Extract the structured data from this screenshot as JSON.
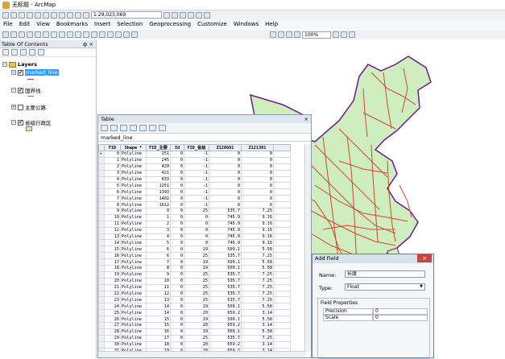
{
  "window": {
    "title": "无标题 - ArcMap"
  },
  "toolbar": {
    "scale": "1:29,023,069",
    "zoom": "100%"
  },
  "menu": [
    "File",
    "Edit",
    "View",
    "Bookmarks",
    "Insert",
    "Selection",
    "Geoprocessing",
    "Customize",
    "Windows",
    "Help"
  ],
  "toc": {
    "title": "Table Of Contents",
    "pin": "ф ×",
    "layers_label": "Layers",
    "layers": [
      {
        "name": "marked_line",
        "checked": "✔",
        "selected": true
      },
      {
        "name": "国界线",
        "checked": "✔"
      },
      {
        "name": "主要公路",
        "checked": ""
      },
      {
        "name": "省级行政区",
        "checked": "✔"
      }
    ]
  },
  "table": {
    "title": "Table",
    "tab_name": "marked_line",
    "columns": [
      "FID",
      "Shape *",
      "FID_主要",
      "Id",
      "FID_省级",
      "Z120601",
      "Z121301"
    ],
    "rows": [
      [
        "0",
        "Polyline",
        "251",
        "0",
        "-1",
        "0",
        "0"
      ],
      [
        "1",
        "Polyline",
        "245",
        "0",
        "-1",
        "0",
        "0"
      ],
      [
        "2",
        "Polyline",
        "420",
        "0",
        "-1",
        "0",
        "0"
      ],
      [
        "3",
        "Polyline",
        "421",
        "0",
        "-1",
        "0",
        "0"
      ],
      [
        "4",
        "Polyline",
        "833",
        "0",
        "-1",
        "0",
        "0"
      ],
      [
        "5",
        "Polyline",
        "1251",
        "0",
        "-1",
        "0",
        "0"
      ],
      [
        "6",
        "Polyline",
        "1393",
        "0",
        "-1",
        "0",
        "0"
      ],
      [
        "7",
        "Polyline",
        "1402",
        "0",
        "-1",
        "0",
        "0"
      ],
      [
        "8",
        "Polyline",
        "1612",
        "0",
        "-1",
        "0",
        "0"
      ],
      [
        "9",
        "Polyline",
        "0",
        "0",
        "25",
        "535.7",
        "7.25"
      ],
      [
        "10",
        "Polyline",
        "1",
        "0",
        "0",
        "745.9",
        "9.16"
      ],
      [
        "11",
        "Polyline",
        "2",
        "0",
        "0",
        "745.9",
        "9.16"
      ],
      [
        "12",
        "Polyline",
        "3",
        "0",
        "0",
        "745.9",
        "9.16"
      ],
      [
        "13",
        "Polyline",
        "4",
        "0",
        "0",
        "745.9",
        "9.16"
      ],
      [
        "14",
        "Polyline",
        "5",
        "0",
        "0",
        "745.9",
        "9.16"
      ],
      [
        "15",
        "Polyline",
        "6",
        "0",
        "19",
        "509.1",
        "5.58"
      ],
      [
        "16",
        "Polyline",
        "6",
        "0",
        "25",
        "535.7",
        "7.25"
      ],
      [
        "17",
        "Polyline",
        "7",
        "0",
        "19",
        "509.1",
        "5.58"
      ],
      [
        "18",
        "Polyline",
        "8",
        "0",
        "19",
        "509.1",
        "5.58"
      ],
      [
        "19",
        "Polyline",
        "9",
        "0",
        "25",
        "535.7",
        "7.25"
      ],
      [
        "20",
        "Polyline",
        "10",
        "0",
        "25",
        "535.7",
        "7.25"
      ],
      [
        "21",
        "Polyline",
        "11",
        "0",
        "25",
        "535.7",
        "7.25"
      ],
      [
        "22",
        "Polyline",
        "12",
        "0",
        "25",
        "535.7",
        "7.25"
      ],
      [
        "23",
        "Polyline",
        "13",
        "0",
        "25",
        "535.7",
        "7.25"
      ],
      [
        "24",
        "Polyline",
        "14",
        "0",
        "19",
        "509.1",
        "5.58"
      ],
      [
        "25",
        "Polyline",
        "14",
        "0",
        "20",
        "659.2",
        "3.14"
      ],
      [
        "26",
        "Polyline",
        "15",
        "0",
        "19",
        "509.1",
        "5.58"
      ],
      [
        "27",
        "Polyline",
        "15",
        "0",
        "20",
        "659.2",
        "3.14"
      ],
      [
        "28",
        "Polyline",
        "16",
        "0",
        "19",
        "509.1",
        "5.58"
      ],
      [
        "29",
        "Polyline",
        "17",
        "0",
        "25",
        "535.7",
        "7.25"
      ],
      [
        "30",
        "Polyline",
        "18",
        "0",
        "20",
        "659.2",
        "3.14"
      ],
      [
        "31",
        "Polyline",
        "19",
        "0",
        "20",
        "659.2",
        "3.14"
      ]
    ]
  },
  "add_field": {
    "title": "Add Field",
    "name_label": "Name:",
    "name_value": "长度",
    "type_label": "Type:",
    "type_value": "Float",
    "props_label": "Field Properties",
    "precision_label": "Precision",
    "precision_value": "0",
    "scale_label": "Scale",
    "scale_value": "0"
  },
  "colors": {
    "land": "#cfeec0",
    "roads": "#d4452a",
    "border": "#6b1a8a"
  }
}
